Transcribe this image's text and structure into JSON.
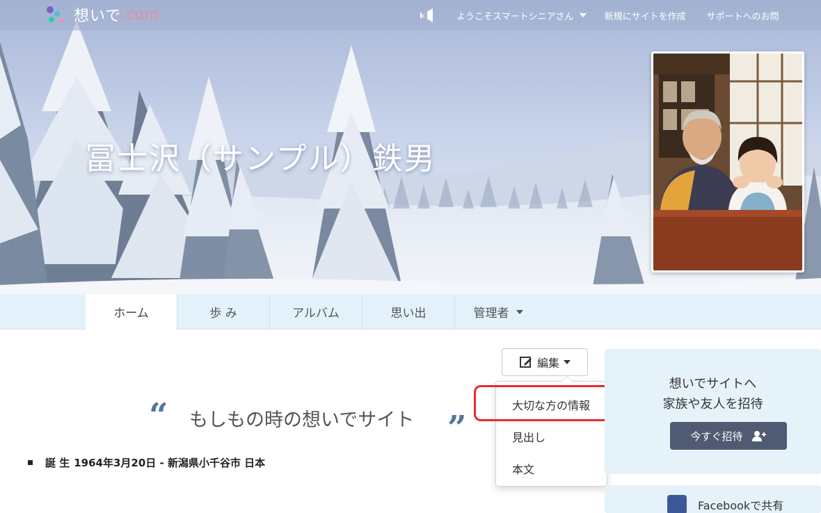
{
  "header": {
    "logo_text": "想いで",
    "logo_suffix": ".com",
    "welcome": "ようこそスマートシニアさん",
    "create_site": "新規にサイトを作成",
    "support": "サポートへのお問"
  },
  "hero": {
    "title": "冨士沢（サンプル）鉄男"
  },
  "tabs": [
    {
      "label": "ホーム"
    },
    {
      "label": "歩 み"
    },
    {
      "label": "アルバム"
    },
    {
      "label": "思い出"
    },
    {
      "label": "管理者"
    }
  ],
  "edit": {
    "label": "編集",
    "menu": [
      "大切な方の情報",
      "見出し",
      "本文"
    ]
  },
  "content": {
    "quote": "もしもの時の想いでサイト",
    "open_quote": "“",
    "close_quote": "”",
    "birth_label": "誕 生",
    "birth_value": "1964年3月20日 - 新潟県小千谷市 日本"
  },
  "sidebar": {
    "invite_line1": "想いでサイトへ",
    "invite_line2": "家族や友人を招待",
    "invite_button": "今すぐ招待",
    "fb_label": "Facebookで共有"
  },
  "colors": {
    "highlight": "#e8282e",
    "tab_bar": "#e2f1fa",
    "invite_button": "#505a72"
  }
}
